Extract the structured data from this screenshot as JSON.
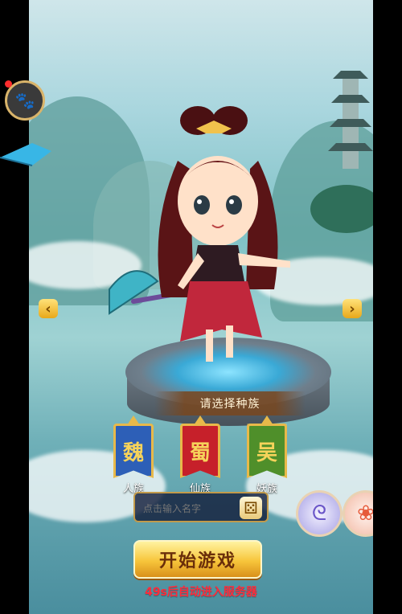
{
  "race_select": {
    "title": "请选择种族",
    "races": [
      {
        "glyph": "魏",
        "label": "人族",
        "color": "#2d5fb7"
      },
      {
        "glyph": "蜀",
        "label": "仙族",
        "color": "#c6202a"
      },
      {
        "glyph": "吴",
        "label": "妖族",
        "color": "#4f8f2a"
      }
    ]
  },
  "name_input": {
    "value": "",
    "placeholder": "点击输入名字"
  },
  "start_button": {
    "label": "开始游戏"
  },
  "auto_enter_text": "49s后自动进入服务器",
  "icons": {
    "dice": "dice-icon",
    "left_arrow": "prev-arrow-icon",
    "right_arrow": "next-arrow-icon",
    "swirl": "swirl-icon",
    "lotus": "lotus-icon"
  }
}
